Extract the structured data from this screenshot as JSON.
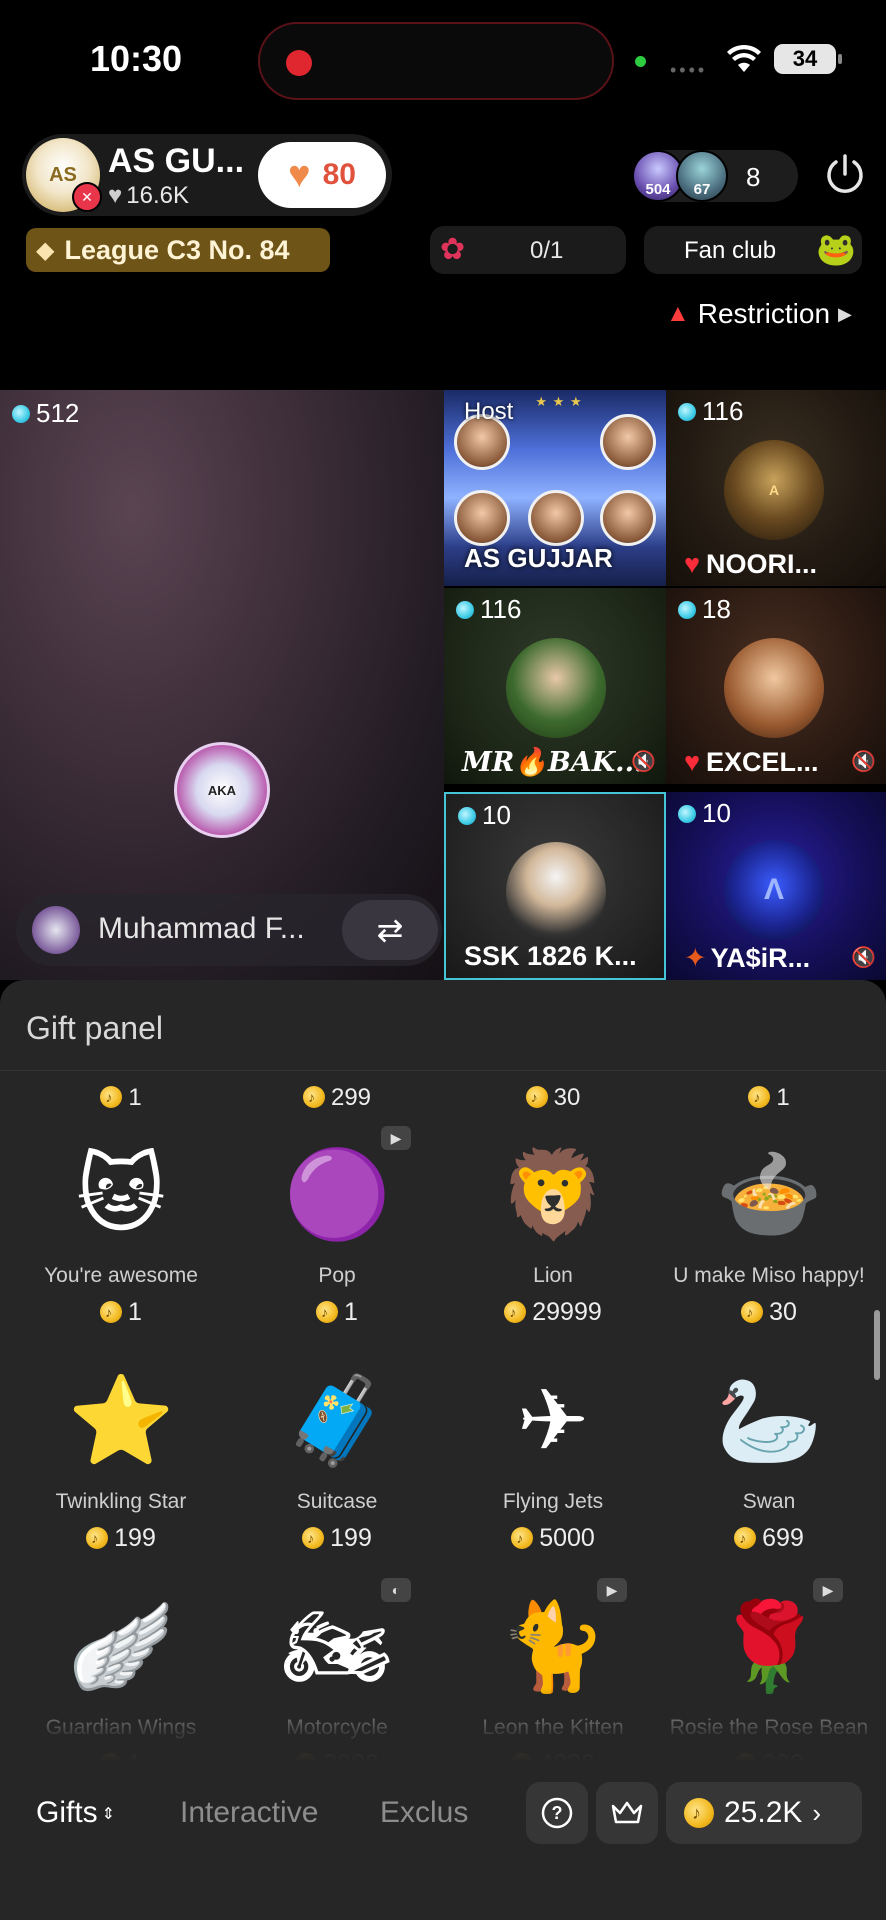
{
  "status_bar": {
    "time": "10:30",
    "battery": "34"
  },
  "host": {
    "name": "AS GU...",
    "likes": "16.6K",
    "heart_count": "80",
    "viewer_avatar_1": "504",
    "viewer_avatar_2": "67",
    "viewer_count": "8",
    "league": "League C3 No. 84",
    "task_progress": "0/1",
    "fan_club": "Fan club",
    "restriction": "Restriction"
  },
  "stage": {
    "main": {
      "score": "512",
      "name": "Muhammad F..."
    },
    "tiles": [
      {
        "label": "Host",
        "name": "AS GUJJAR"
      },
      {
        "score": "116",
        "name": "NOORI..."
      },
      {
        "score": "116",
        "name": "MR🔥BAK..."
      },
      {
        "score": "18",
        "name": "EXCEL..."
      },
      {
        "score": "10",
        "name": "SSK 1826 K..."
      },
      {
        "score": "10",
        "name": "YA$iR..."
      }
    ]
  },
  "gift_panel": {
    "title": "Gift panel",
    "top_prices": [
      "1",
      "299",
      "30",
      "1"
    ],
    "gifts": [
      {
        "name": "You're awesome",
        "price": "1",
        "icon": "cat-icon"
      },
      {
        "name": "Pop",
        "price": "1",
        "icon": "pop-icon"
      },
      {
        "name": "Lion",
        "price": "29999",
        "icon": "lion-icon"
      },
      {
        "name": "U make Miso happy!",
        "price": "30",
        "icon": "miso-icon"
      },
      {
        "name": "Twinkling Star",
        "price": "199",
        "icon": "star-icon"
      },
      {
        "name": "Suitcase",
        "price": "199",
        "icon": "suitcase-icon"
      },
      {
        "name": "Flying Jets",
        "price": "5000",
        "icon": "jets-icon"
      },
      {
        "name": "Swan",
        "price": "699",
        "icon": "swan-icon"
      },
      {
        "name": "Guardian Wings",
        "price": "1",
        "icon": "wings-icon"
      },
      {
        "name": "Motorcycle",
        "price": "2988",
        "icon": "motorcycle-icon"
      },
      {
        "name": "Leon the Kitten",
        "price": "4888",
        "icon": "kitten-icon"
      },
      {
        "name": "Rosie the Rose Bean",
        "price": "399",
        "icon": "rose-bean-icon"
      }
    ],
    "tabs": [
      "Gifts",
      "Interactive",
      "Exclus"
    ],
    "balance": "25.2K"
  }
}
